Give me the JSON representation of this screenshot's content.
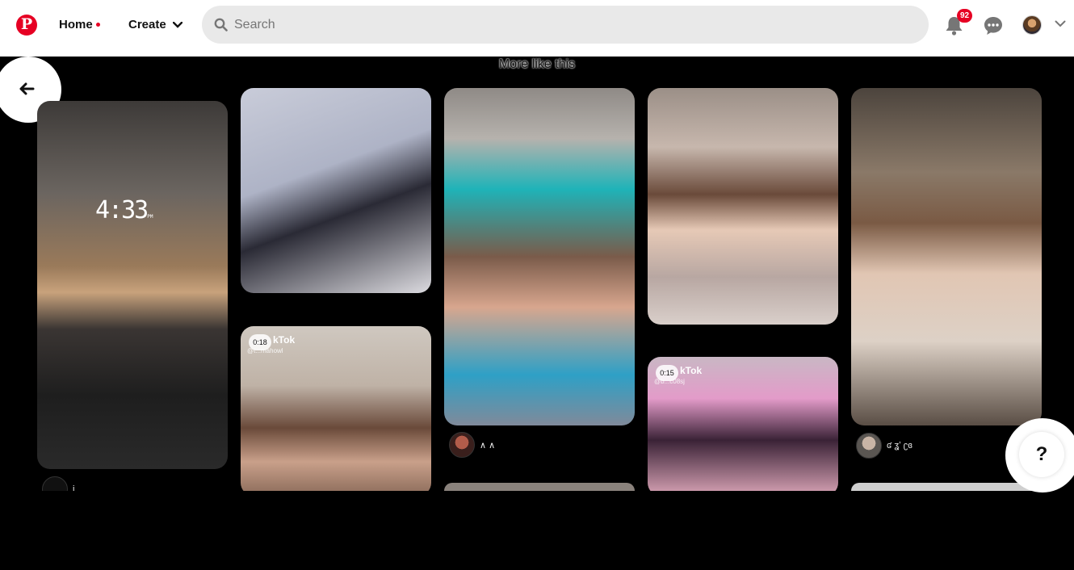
{
  "header": {
    "logo_letter": "P",
    "home_label": "Home",
    "create_label": "Create",
    "search_placeholder": "Search",
    "notification_count": "92"
  },
  "section_title": "More like this",
  "pins": [
    {
      "id": "pin-1",
      "author": "i",
      "clock_text": "4:33",
      "clock_suffix": "PM"
    },
    {
      "id": "pin-2",
      "author": ""
    },
    {
      "id": "pin-3",
      "author": "∧ ∧"
    },
    {
      "id": "pin-4",
      "author": ""
    },
    {
      "id": "pin-5",
      "author": "ʛ ʓʼ ʗɞ"
    },
    {
      "id": "pin-6",
      "duration": "0:18",
      "watermark": "kTok",
      "watermark_sub": "@t...mahowl"
    },
    {
      "id": "pin-7",
      "duration": "0:15",
      "watermark": "kTok",
      "watermark_sub": "@b...c08sj"
    }
  ],
  "help_label": "?",
  "colors": {
    "brand": "#e60023",
    "search_bg": "#e9e9e9"
  }
}
